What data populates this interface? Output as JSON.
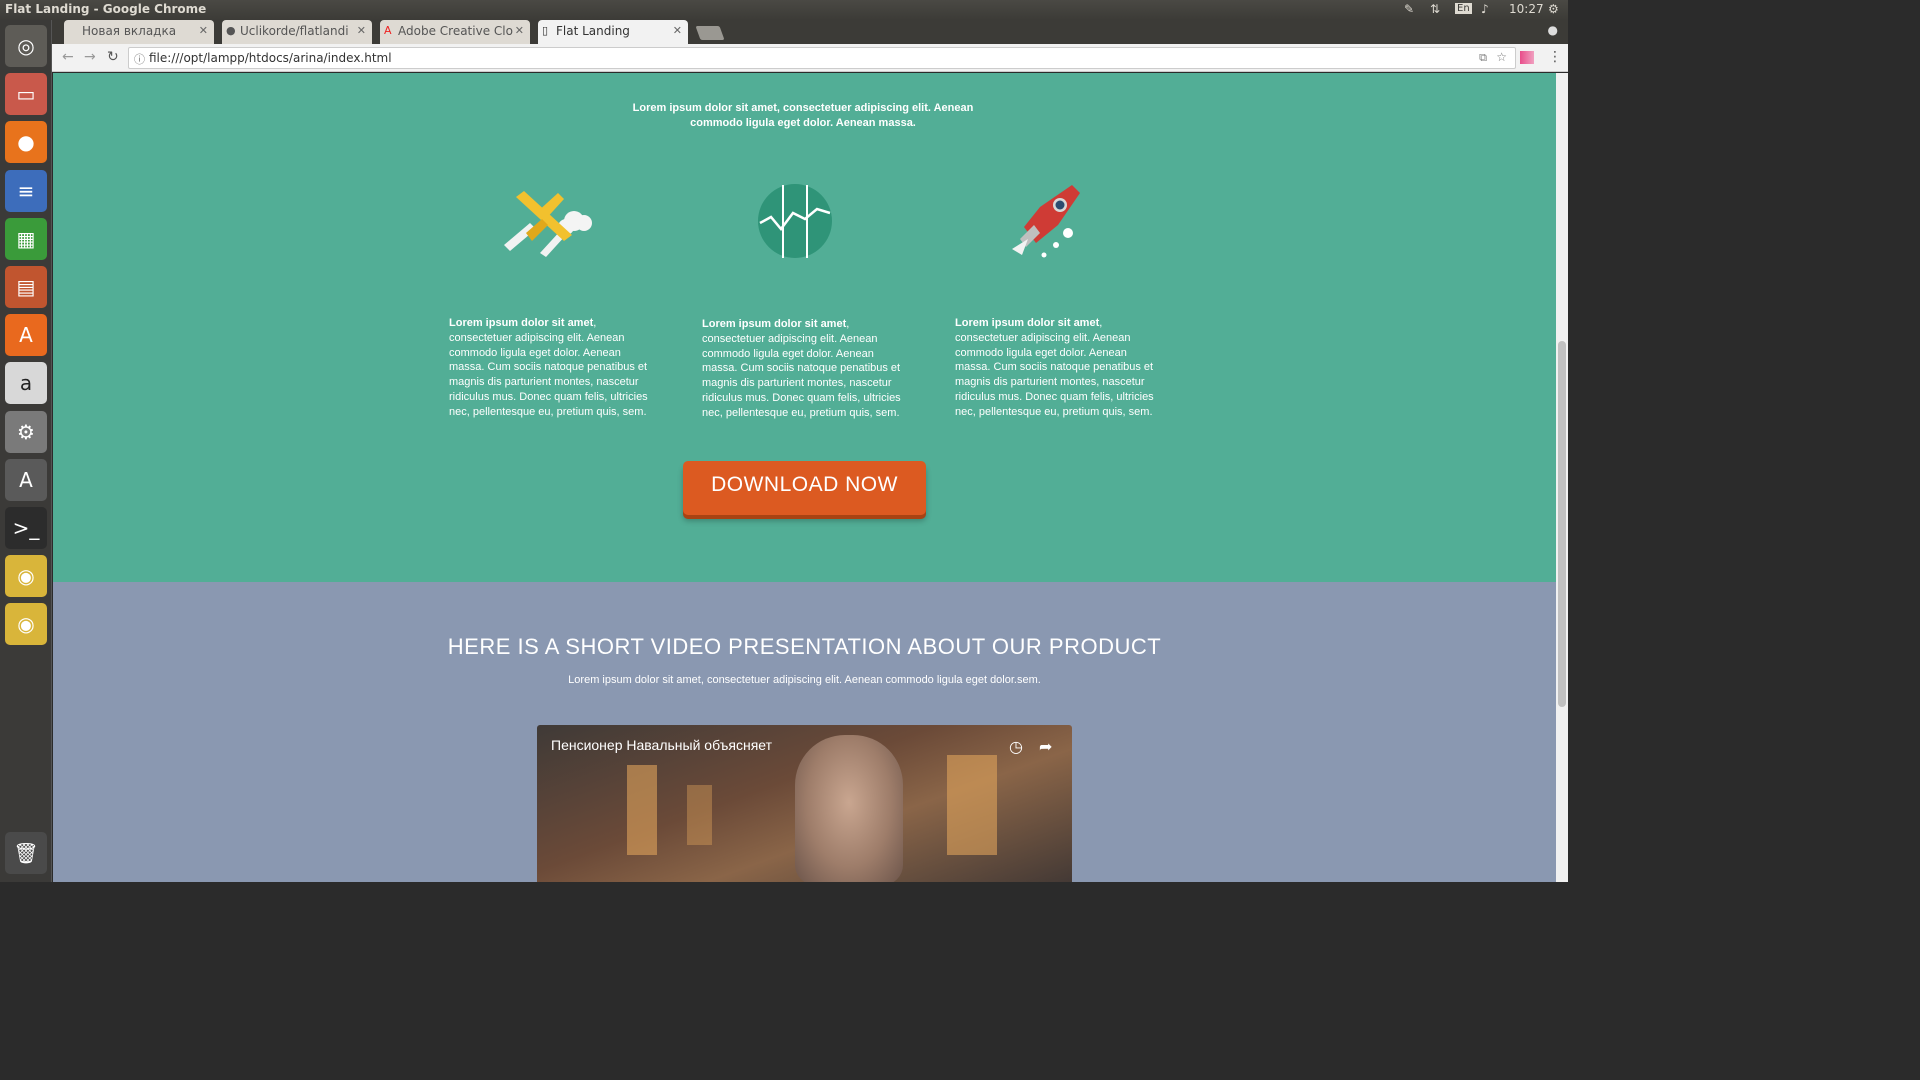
{
  "os": {
    "window_title": "Flat Landing - Google Chrome",
    "lang": "En",
    "time": "10:27"
  },
  "launcher": [
    {
      "name": "ubuntu-dash-icon",
      "glyph": "◎",
      "bg": "#5e5c57"
    },
    {
      "name": "files-icon",
      "glyph": "▭",
      "bg": "#c9594b"
    },
    {
      "name": "firefox-icon",
      "glyph": "●",
      "bg": "#e8731c"
    },
    {
      "name": "writer-icon",
      "glyph": "≡",
      "bg": "#3d6dbb"
    },
    {
      "name": "calc-icon",
      "glyph": "▦",
      "bg": "#3a9b3a"
    },
    {
      "name": "impress-icon",
      "glyph": "▤",
      "bg": "#c1552f"
    },
    {
      "name": "software-center-icon",
      "glyph": "A",
      "bg": "#e9691e"
    },
    {
      "name": "amazon-icon",
      "glyph": "a",
      "bg": "#d8d8d8"
    },
    {
      "name": "settings-icon",
      "glyph": "⚙",
      "bg": "#7a7a7a"
    },
    {
      "name": "updater-icon",
      "glyph": "A",
      "bg": "#5a5a5a"
    },
    {
      "name": "terminal-icon",
      "glyph": ">_",
      "bg": "#2c2c2c"
    },
    {
      "name": "chrome-icon",
      "glyph": "◉",
      "bg": "#d9b53a"
    },
    {
      "name": "chrome-icon-2",
      "glyph": "◉",
      "bg": "#d9b53a"
    }
  ],
  "tabs": [
    {
      "label": "Новая вкладка",
      "fav": ""
    },
    {
      "label": "Uclikorde/flatlandi",
      "fav": "●"
    },
    {
      "label": "Adobe Creative Clo",
      "fav": "A"
    },
    {
      "label": "Flat Landing",
      "fav": "▯"
    }
  ],
  "address": "file:///opt/lampp/htdocs/arina/index.html",
  "intro": "Lorem ipsum dolor sit amet, consectetuer adipiscing elit. Aenean commodo ligula eget dolor. Aenean massa.",
  "features": [
    {
      "bold": "Lorem ipsum dolor sit amet",
      "text": ", consectetuer adipiscing elit. Aenean commodo ligula eget dolor. Aenean massa. Cum sociis natoque penatibus et magnis dis parturient montes, nascetur ridiculus mus. Donec quam felis, ultricies nec, pellentesque eu, pretium quis, sem."
    },
    {
      "bold": "Lorem ipsum dolor sit amet",
      "text": ", consectetuer adipiscing elit. Aenean commodo ligula eget dolor. Aenean massa. Cum sociis natoque penatibus et magnis dis parturient montes, nascetur ridiculus mus. Donec quam felis, ultricies nec, pellentesque eu, pretium quis, sem."
    },
    {
      "bold": "Lorem ipsum dolor sit amet",
      "text": ", consectetuer adipiscing elit. Aenean commodo ligula eget dolor. Aenean massa. Cum sociis natoque penatibus et magnis dis parturient montes, nascetur ridiculus mus. Donec quam felis, ultricies nec, pellentesque eu, pretium quis, sem."
    }
  ],
  "download_label": "DOWNLOAD NOW",
  "video_section": {
    "heading": "HERE IS A SHORT VIDEO PRESENTATION ABOUT OUR PRODUCT",
    "sub": "Lorem ipsum dolor sit amet, consectetuer adipiscing elit. Aenean commodo ligula eget dolor.sem.",
    "video_title": "Пенсионер Навальный объясняет"
  },
  "colors": {
    "teal": "#52ae96",
    "orange": "#dc5a21",
    "slate": "#8a98b1"
  }
}
